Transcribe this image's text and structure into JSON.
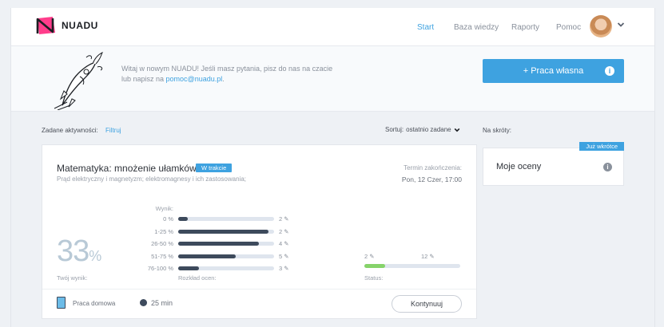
{
  "header": {
    "brand": "NUADU",
    "nav": [
      {
        "label": "Start",
        "active": true
      },
      {
        "label": "Baza wiedzy",
        "active": false
      },
      {
        "label": "Raporty",
        "active": false
      },
      {
        "label": "Pomoc",
        "active": false
      }
    ]
  },
  "welcome": {
    "text_line1": "Witaj w nowym NUADU! Jeśli masz pytania, pisz do nas na czacie",
    "text_line2_prefix": "lub napisz na ",
    "email": "pomoc@nuadu.pl",
    "text_line2_suffix": ".",
    "primary_button": "+ Praca własna",
    "info_glyph": "i"
  },
  "activities": {
    "label": "Zadane aktywności:",
    "filter": "Filtruj",
    "sort_label": "Sortuj:",
    "sort_value": "ostatnio zadane",
    "shortcuts_label": "Na skróty:"
  },
  "card": {
    "title": "Matematyka: mnożenie ułamków",
    "badge": "W trakcie",
    "subtitle": "Prąd elektryczny i magnetyzm; elektromagnesy i ich zastosowania;",
    "term_label": "Termin zakończenia:",
    "term_value": "Pon, 12 Czer, 17:00",
    "score": "33",
    "score_unit": "%",
    "score_label": "Twój wynik:",
    "dist_header": "Wynik:",
    "dist_footer": "Rozkład ocen:",
    "distribution": [
      {
        "range": "0 %",
        "count": "2",
        "fraction": 0.1
      },
      {
        "range": "1-25 %",
        "count": "2",
        "fraction": 0.94
      },
      {
        "range": "26-50 %",
        "count": "4",
        "fraction": 0.84
      },
      {
        "range": "51-75 %",
        "count": "5",
        "fraction": 0.6
      },
      {
        "range": "76-100 %",
        "count": "3",
        "fraction": 0.22
      }
    ],
    "status_done": "2",
    "status_total": "12",
    "status_fraction": 0.22,
    "status_label": "Status:",
    "type": "Praca domowa",
    "time": "25 min",
    "continue_button": "Kontynuuj"
  },
  "shortcut_card": {
    "badge": "Już wkrótce",
    "title": "Moje oceny",
    "info_glyph": "i"
  },
  "colors": {
    "accent": "#3ea2e0",
    "bar_dark": "#3d4a5c",
    "status_green": "#86d36a"
  }
}
